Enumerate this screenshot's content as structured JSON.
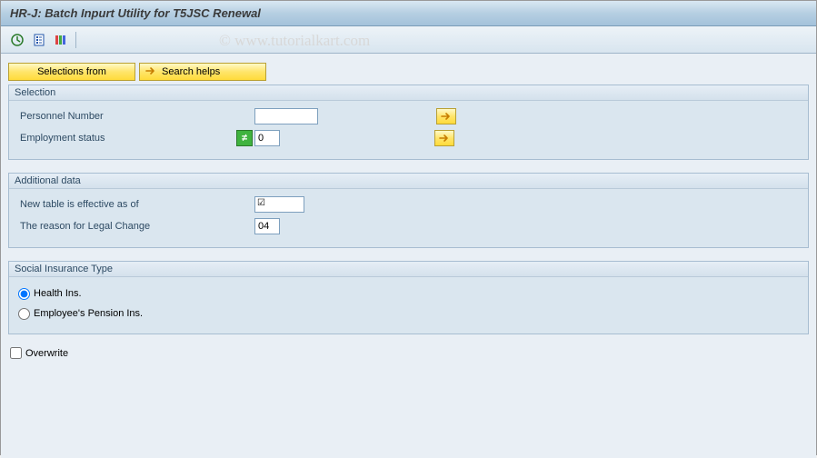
{
  "title": "HR-J: Batch Inpurt Utility for T5JSC Renewal",
  "watermark": "© www.tutorialkart.com",
  "toolbar": {
    "execute": "Execute",
    "overview": "Overview",
    "variants": "Variants"
  },
  "buttons": {
    "selections_from": "Selections from",
    "search_helps": "Search helps"
  },
  "group_selection": {
    "title": "Selection",
    "personnel_number_label": "Personnel Number",
    "personnel_number_value": "",
    "employment_status_label": "Employment status",
    "employment_status_value": "0"
  },
  "group_additional": {
    "title": "Additional data",
    "effective_label": "New table is effective as of",
    "effective_value": "",
    "reason_label": "The reason for Legal Change",
    "reason_value": "04"
  },
  "group_social": {
    "title": "Social Insurance Type",
    "health_label": "Health Ins.",
    "pension_label": "Employee's Pension Ins.",
    "selected": "health"
  },
  "overwrite_label": "Overwrite",
  "overwrite_checked": false,
  "icons": {
    "arrow_right": "➡",
    "not_equal": "≠",
    "check": "✓"
  }
}
